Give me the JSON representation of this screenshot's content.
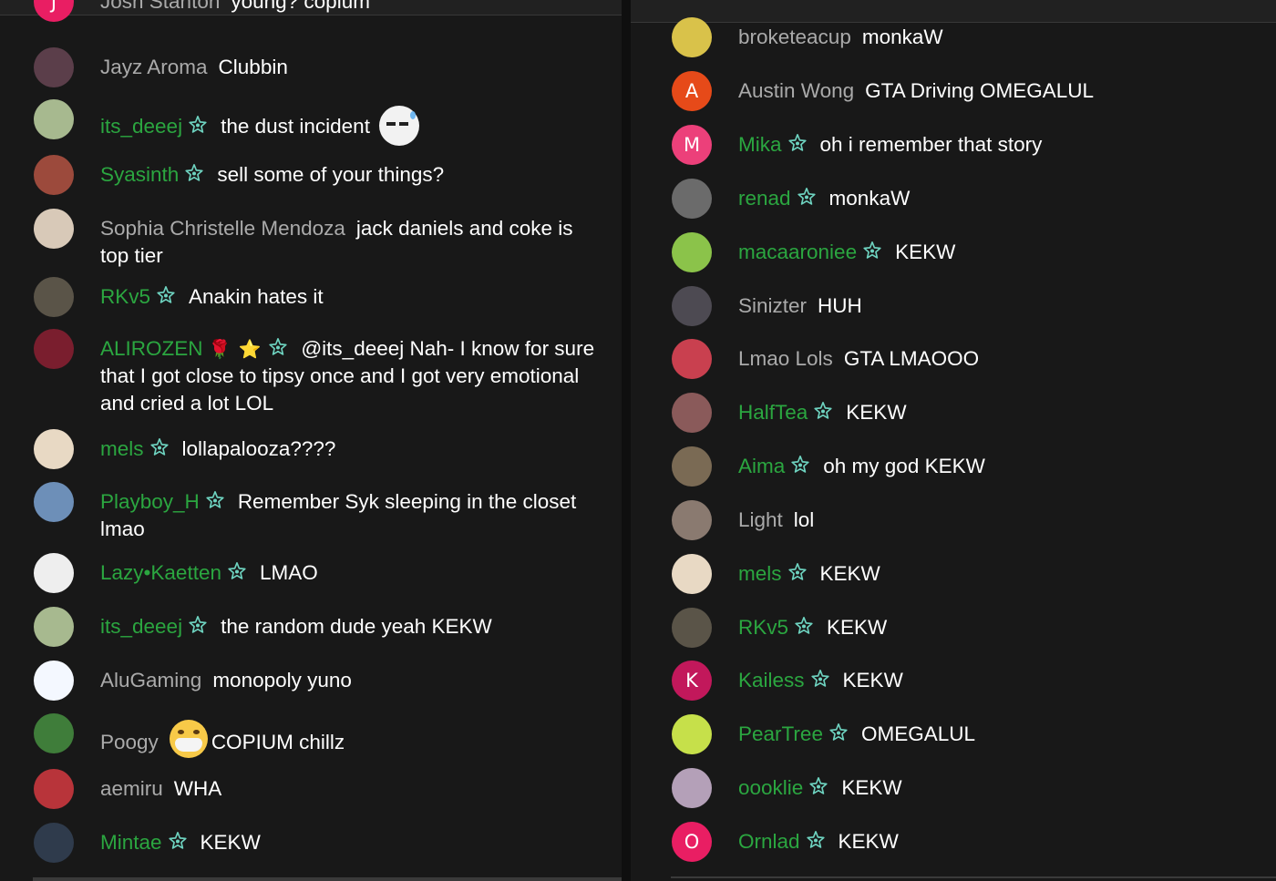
{
  "left_chat": [
    {
      "author": "Josh Stanton",
      "member": false,
      "text": "young? copium",
      "avatar_color": "#e91e63",
      "avatar_letter": "J"
    },
    {
      "author": "Jayz Aroma",
      "member": false,
      "text": "Clubbin",
      "avatar_color": "#5b3e4a"
    },
    {
      "author": "its_deeej",
      "member": true,
      "text": "the dust incident",
      "avatar_color": "#a7b98f",
      "emote": "sweat-pepe-emote"
    },
    {
      "author": "Syasinth",
      "member": true,
      "text": "sell some of your things?",
      "avatar_color": "#9c4a3c"
    },
    {
      "author": "Sophia Christelle Mendoza",
      "member": false,
      "text": "jack daniels and coke is top tier",
      "avatar_color": "#d8c9b8"
    },
    {
      "author": "RKv5",
      "member": true,
      "text": "Anakin hates it",
      "avatar_color": "#5a5448"
    },
    {
      "author": "ALIROZEN",
      "member": true,
      "text": "@its_deeej Nah- I know for sure that I got close to tipsy once and I got very emotional and cried a lot LOL",
      "avatar_color": "#7a1e2e",
      "name_emojis": [
        "🌹",
        "⭐"
      ]
    },
    {
      "author": "mels",
      "member": true,
      "text": "lollapalooza????",
      "avatar_color": "#e8d9c4"
    },
    {
      "author": "Playboy_H",
      "member": true,
      "text": "Remember Syk sleeping in the closet lmao",
      "avatar_color": "#6d8fb8"
    },
    {
      "author": "Lazy•Kaetten",
      "member": true,
      "text": "LMAO",
      "avatar_color": "#eeeeee"
    },
    {
      "author": "its_deeej",
      "member": true,
      "text": "the random dude yeah KEKW",
      "avatar_color": "#a7b98f"
    },
    {
      "author": "AluGaming",
      "member": false,
      "text": "monopoly yuno",
      "avatar_color": "#f4f8ff"
    },
    {
      "author": "Poogy",
      "member": false,
      "text": "COPIUM chillz",
      "avatar_color": "#3f7d3a",
      "emote": "mask-emoji"
    },
    {
      "author": "aemiru",
      "member": false,
      "text": "WHA",
      "avatar_color": "#b8343a"
    },
    {
      "author": "Mintae",
      "member": true,
      "text": "KEKW",
      "avatar_color": "#2f3b4c"
    }
  ],
  "right_chat": [
    {
      "author": "broketeacup",
      "member": false,
      "text": "monkaW",
      "avatar_color": "#d9c24a"
    },
    {
      "author": "Austin Wong",
      "member": false,
      "text": "GTA Driving OMEGALUL",
      "avatar_color": "#e64a19",
      "avatar_letter": "A"
    },
    {
      "author": "Mika",
      "member": true,
      "text": "oh i remember that story",
      "avatar_color": "#ec407a",
      "avatar_letter": "M"
    },
    {
      "author": "renad",
      "member": true,
      "text": "monkaW",
      "avatar_color": "#6b6b6b"
    },
    {
      "author": "macaaroniee",
      "member": true,
      "text": "KEKW",
      "avatar_color": "#8bc34a"
    },
    {
      "author": "Sinizter",
      "member": false,
      "text": "HUH",
      "avatar_color": "#4d4a52"
    },
    {
      "author": "Lmao Lols",
      "member": false,
      "text": "GTA LMAOOO",
      "avatar_color": "#c9404f"
    },
    {
      "author": "HalfTea",
      "member": true,
      "text": "KEKW",
      "avatar_color": "#8a5a5a"
    },
    {
      "author": "Aima",
      "member": true,
      "text": "oh my god KEKW",
      "avatar_color": "#7a6a54"
    },
    {
      "author": "Light",
      "member": false,
      "text": "lol",
      "avatar_color": "#8a7a70"
    },
    {
      "author": "mels",
      "member": true,
      "text": "KEKW",
      "avatar_color": "#e8d9c4"
    },
    {
      "author": "RKv5",
      "member": true,
      "text": "KEKW",
      "avatar_color": "#5a5448"
    },
    {
      "author": "Kailess",
      "member": true,
      "text": "KEKW",
      "avatar_color": "#c2185b",
      "avatar_letter": "K"
    },
    {
      "author": "PearTree",
      "member": true,
      "text": "OMEGALUL",
      "avatar_color": "#c6e04a"
    },
    {
      "author": "oooklie",
      "member": true,
      "text": "KEKW",
      "avatar_color": "#b4a0b8"
    },
    {
      "author": "Ornlad",
      "member": true,
      "text": "KEKW",
      "avatar_color": "#e91e63",
      "avatar_letter": "O"
    }
  ],
  "colors": {
    "background": "#181818",
    "member_name": "#2ba640",
    "author_name": "#aaaaaa",
    "message_text": "#ffffff",
    "badge_teal": "#6ed3c0"
  },
  "icons": {
    "member_badge": "star-member-badge-icon"
  }
}
